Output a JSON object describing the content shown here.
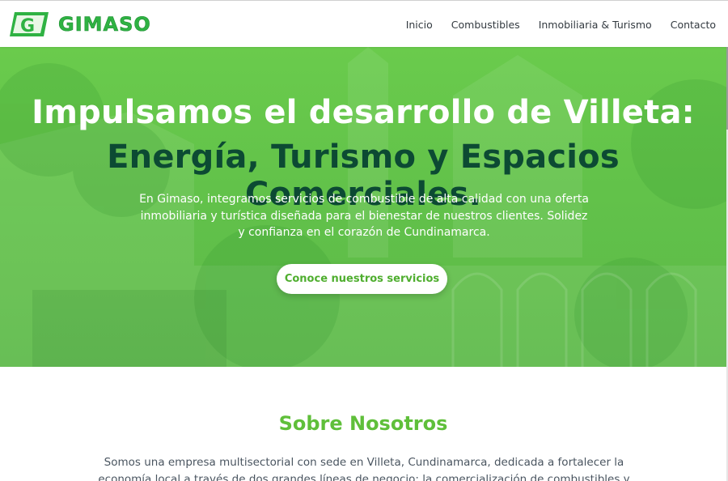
{
  "brand": {
    "name": "GIMASO",
    "mark_letter": "G"
  },
  "nav": [
    {
      "label": "Inicio"
    },
    {
      "label": "Combustibles"
    },
    {
      "label": "Inmobiliaria & Turismo"
    },
    {
      "label": "Contacto"
    }
  ],
  "hero": {
    "title_line1": "Impulsamos el desarrollo de Villeta:",
    "title_line2": "Energía, Turismo y Espacios Comerciales.",
    "description": "En Gimaso, integramos servicios de combustible de alta calidad con una oferta inmobiliaria y turística diseñada para el bienestar de nuestros clientes. Solidez y confianza en el corazón de Cundinamarca.",
    "cta_label": "Conoce nuestros servicios"
  },
  "about": {
    "title": "Sobre Nosotros",
    "text": "Somos una empresa multisectorial con sede en Villeta, Cundinamarca, dedicada a fortalecer la economía local a través de dos grandes líneas de negocio: la comercialización de combustibles y la gestión de activos"
  },
  "colors": {
    "brand_green": "#2fb243",
    "hero_green": "#62c24a",
    "title_dark": "#0c4a33",
    "accent": "#5fbf3a",
    "nav_text": "#333a40"
  }
}
